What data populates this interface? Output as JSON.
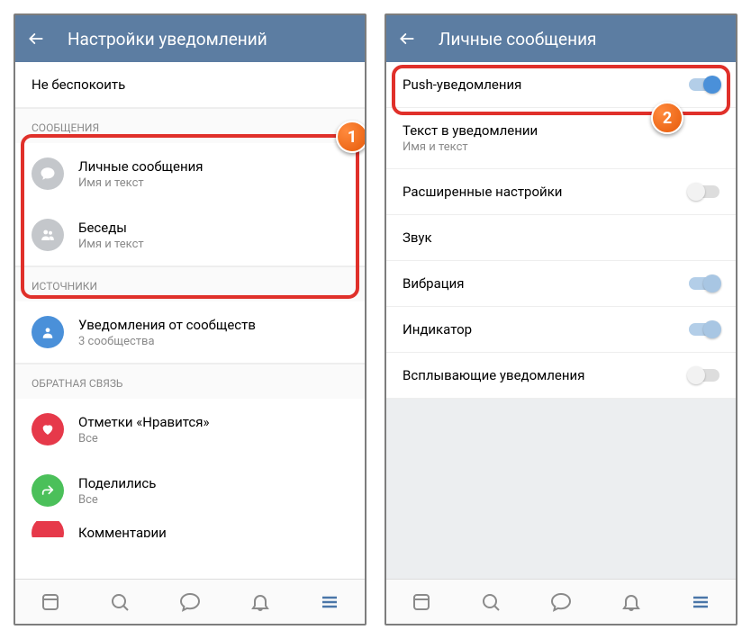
{
  "left": {
    "header": {
      "title": "Настройки уведомлений"
    },
    "dnd": "Не беспокоить",
    "section_messages": "СООБЩЕНИЯ",
    "personal": {
      "title": "Личные сообщения",
      "sub": "Имя и текст"
    },
    "chats": {
      "title": "Беседы",
      "sub": "Имя и текст"
    },
    "section_sources": "ИСТОЧНИКИ",
    "communities": {
      "title": "Уведомления от сообществ",
      "sub": "3 сообщества"
    },
    "section_feedback": "ОБРАТНАЯ СВЯЗЬ",
    "likes": {
      "title": "Отметки «Нравится»",
      "sub": "Все"
    },
    "shares": {
      "title": "Поделились",
      "sub": "Все"
    },
    "comments": {
      "title": "Комментарии"
    }
  },
  "right": {
    "header": {
      "title": "Личные сообщения"
    },
    "push": "Push-уведомления",
    "text_in_notif": {
      "title": "Текст в уведомлении",
      "sub": "Имя и текст"
    },
    "advanced": "Расширенные настройки",
    "sound": "Звук",
    "vibration": "Вибрация",
    "indicator": "Индикатор",
    "popup": "Всплывающие уведомления"
  },
  "callouts": {
    "one": "1",
    "two": "2"
  }
}
